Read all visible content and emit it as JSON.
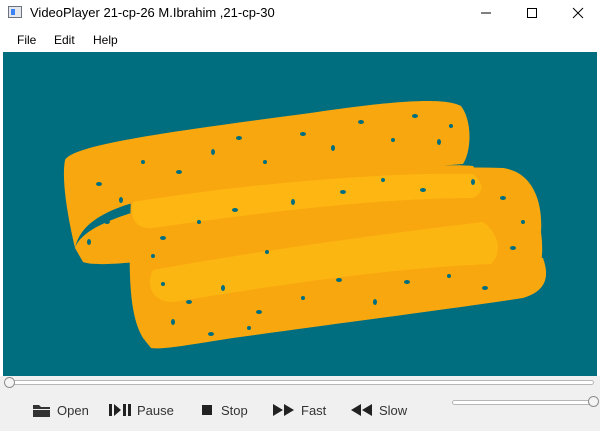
{
  "window": {
    "title": "VideoPlayer 21-cp-26 M.Ibrahim ,21-cp-30",
    "icon": "app-window-icon",
    "controls": {
      "minimize": "─",
      "maximize": "☐",
      "close": "✕"
    }
  },
  "menu": {
    "items": [
      "File",
      "Edit",
      "Help"
    ]
  },
  "video": {
    "background_color": "#006e7f",
    "content": "two orange cheese-covered breadsticks"
  },
  "seek": {
    "progress": 0.0
  },
  "toolbar": {
    "open_label": "Open",
    "pause_label": "Pause",
    "stop_label": "Stop",
    "fast_label": "Fast",
    "slow_label": "Slow",
    "icons": [
      "folder-icon",
      "play-pause-icon",
      "stop-icon",
      "fast-forward-icon",
      "rewind-icon"
    ]
  },
  "volume": {
    "level": 1.0
  }
}
